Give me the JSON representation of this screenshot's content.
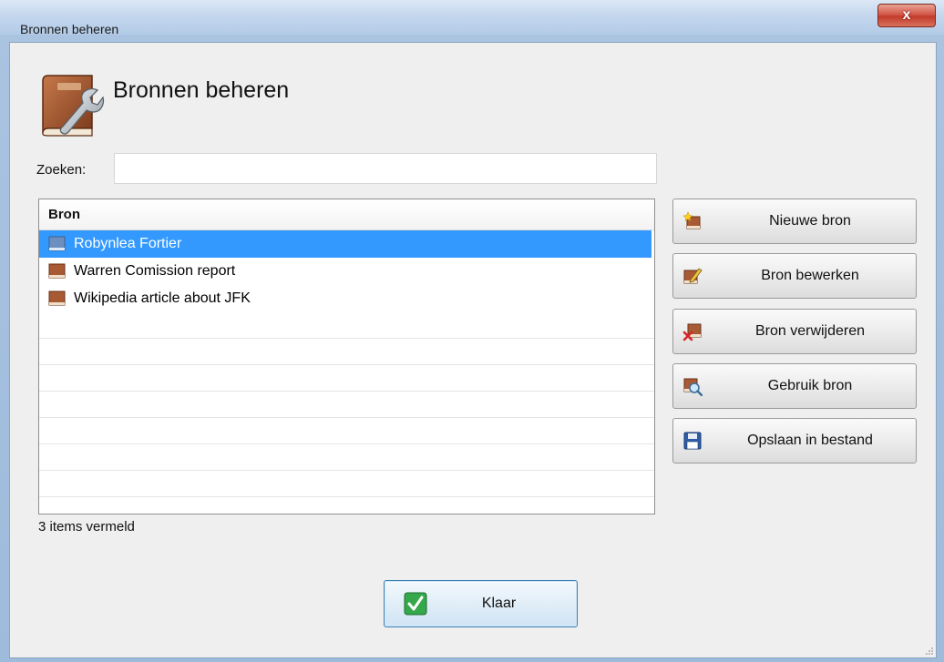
{
  "window": {
    "title": "Bronnen beheren",
    "close_label": "x"
  },
  "header": {
    "title": "Bronnen beheren",
    "icon": "book-wrench-icon"
  },
  "search": {
    "label": "Zoeken:",
    "value": "",
    "placeholder": ""
  },
  "list": {
    "column_header": "Bron",
    "items": [
      {
        "label": "Robynlea Fortier",
        "icon": "book-icon",
        "selected": true
      },
      {
        "label": "Warren Comission report",
        "icon": "book-icon",
        "selected": false
      },
      {
        "label": "Wikipedia article about JFK",
        "icon": "book-icon",
        "selected": false
      }
    ],
    "status": "3 items vermeld"
  },
  "actions": [
    {
      "label": "Nieuwe bron",
      "icon": "new-source-icon"
    },
    {
      "label": "Bron bewerken",
      "icon": "edit-source-icon"
    },
    {
      "label": "Bron verwijderen",
      "icon": "delete-source-icon"
    },
    {
      "label": "Gebruik bron",
      "icon": "use-source-icon"
    },
    {
      "label": "Opslaan in bestand",
      "icon": "save-icon"
    }
  ],
  "footer": {
    "done_label": "Klaar",
    "done_icon": "checkmark-icon"
  },
  "colors": {
    "selection": "#3399ff",
    "accent_border": "#3c7fb1"
  }
}
